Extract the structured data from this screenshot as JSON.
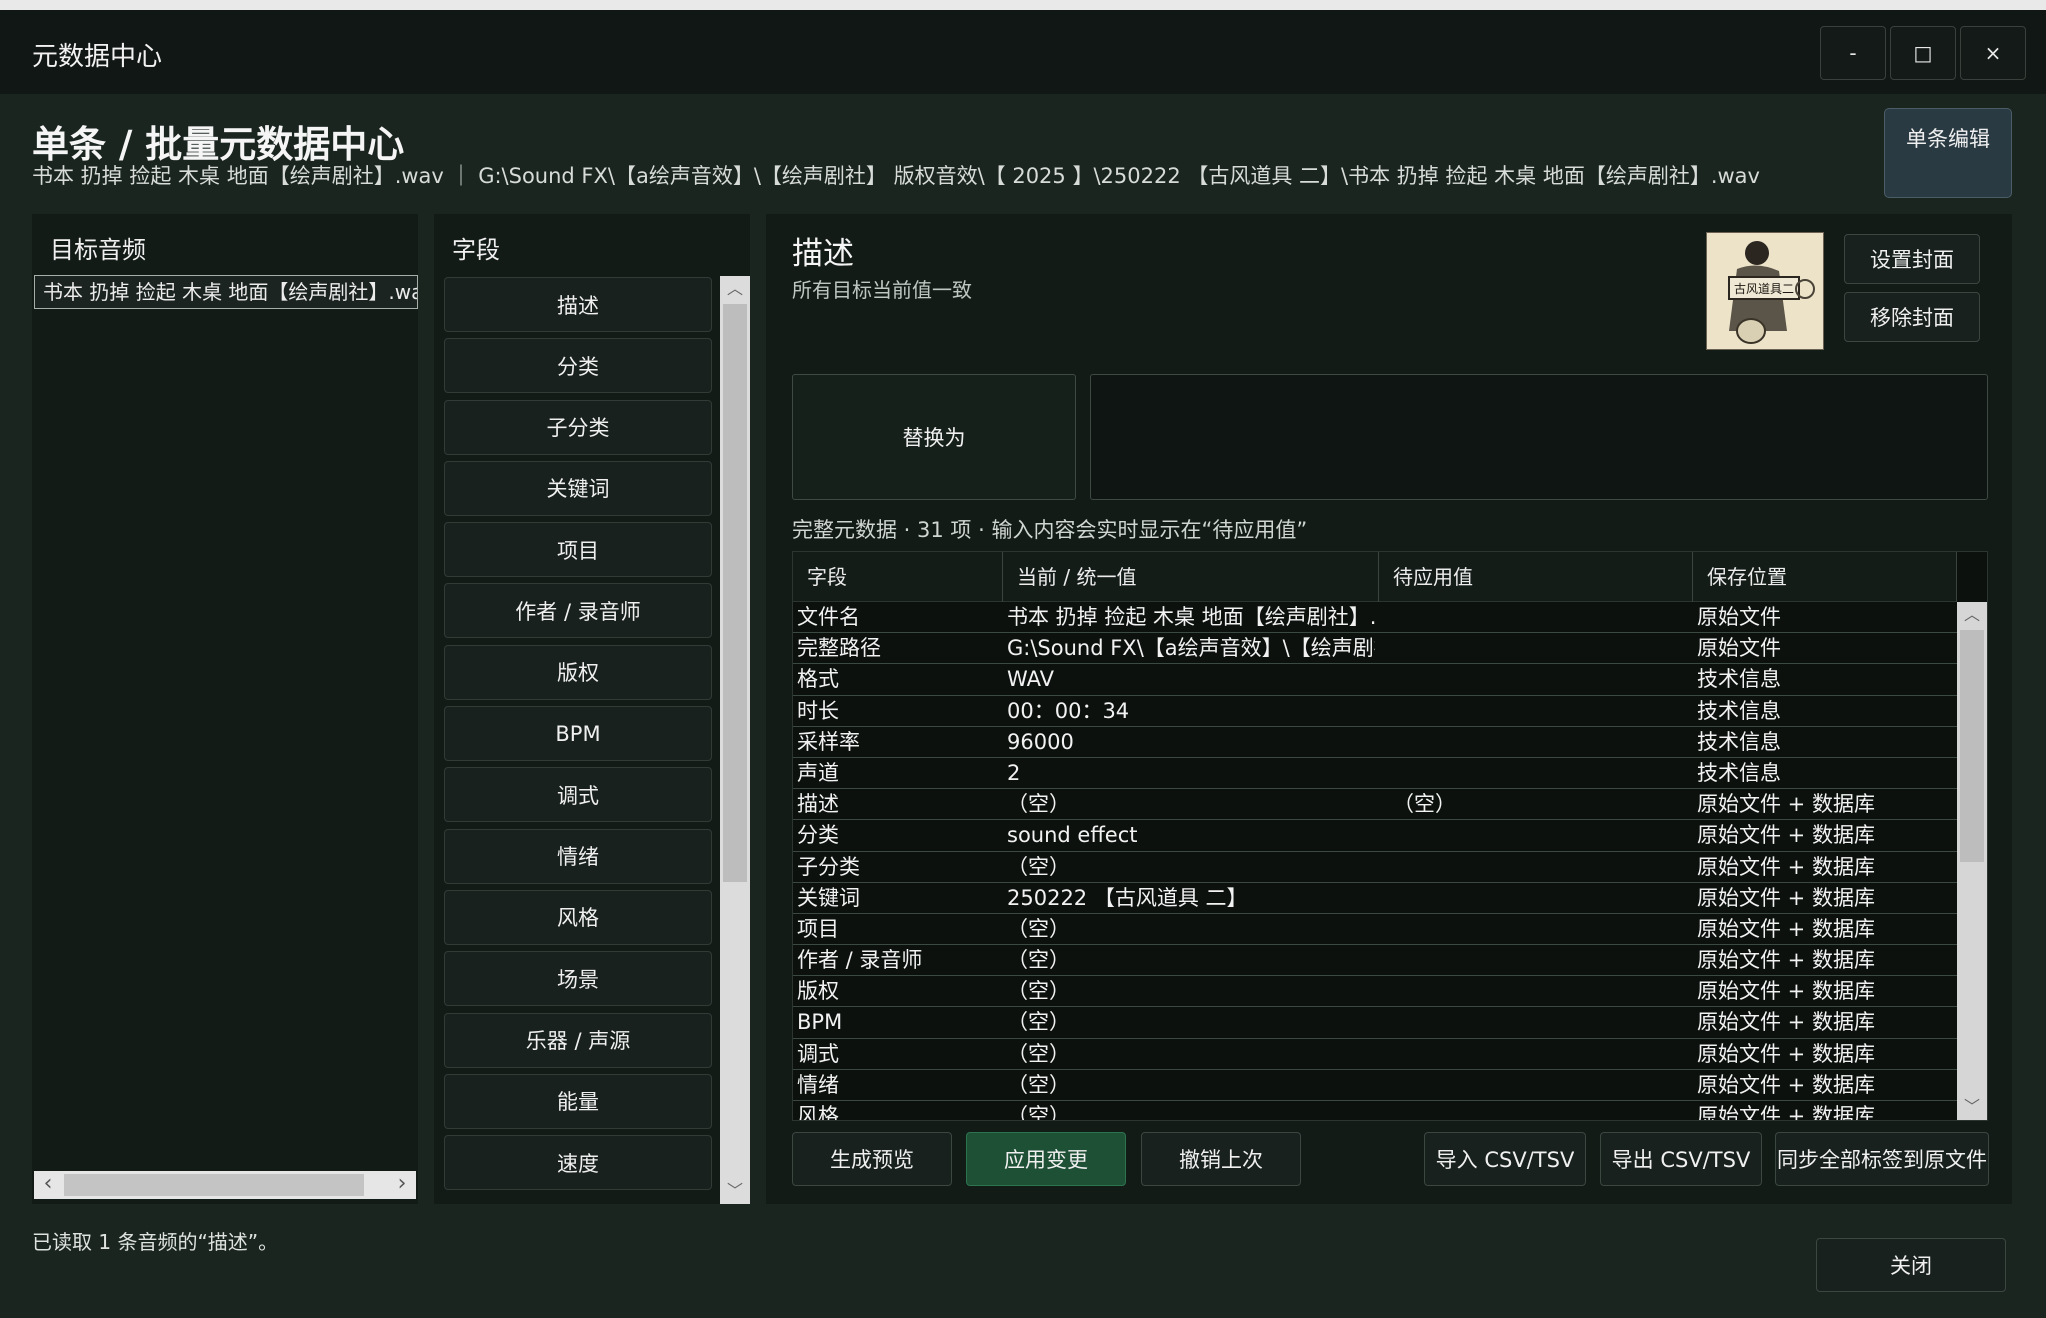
{
  "window": {
    "title": "元数据中心",
    "controls": {
      "minimize": "-",
      "maximize": "□",
      "close": "×"
    }
  },
  "header": {
    "title": "单条 / 批量元数据中心",
    "path": "书本 扔掉 捡起 木桌 地面【绘声剧社】.wav ｜ G:\\Sound FX\\【a绘声音效】\\【绘声剧社】 版权音效\\【 2025 】\\250222 【古风道具 二】\\书本 扔掉 捡起 木桌 地面【绘声剧社】.wav",
    "single_edit_label": "单条编辑"
  },
  "targets": {
    "title": "目标音频",
    "items": [
      "书本 扔掉 捡起 木桌 地面【绘声剧社】.wav"
    ]
  },
  "fields": {
    "title": "字段",
    "items": [
      "描述",
      "分类",
      "子分类",
      "关键词",
      "项目",
      "作者 / 录音师",
      "版权",
      "BPM",
      "调式",
      "情绪",
      "风格",
      "场景",
      "乐器 / 声源",
      "能量",
      "速度"
    ]
  },
  "editor": {
    "field_title": "描述",
    "field_subtitle": "所有目标当前值一致",
    "cover": {
      "text": "古风道具二",
      "set_label": "设置封面",
      "remove_label": "移除封面"
    },
    "replace_label": "替换为",
    "replace_value": "",
    "meta_note": "完整元数据 · 31 项 · 输入内容会实时显示在“待应用值”"
  },
  "table": {
    "columns": [
      "字段",
      "当前 / 统一值",
      "待应用值",
      "保存位置"
    ],
    "rows": [
      [
        "文件名",
        "书本 扔掉 捡起 木桌 地面【绘声剧社】.wav",
        "",
        "原始文件"
      ],
      [
        "完整路径",
        "G:\\Sound FX\\【a绘声音效】\\【绘声剧社】",
        "",
        "原始文件"
      ],
      [
        "格式",
        "WAV",
        "",
        "技术信息"
      ],
      [
        "时长",
        "00：00：34",
        "",
        "技术信息"
      ],
      [
        "采样率",
        "96000",
        "",
        "技术信息"
      ],
      [
        "声道",
        "2",
        "",
        "技术信息"
      ],
      [
        "描述",
        "（空）",
        "（空）",
        "原始文件 + 数据库"
      ],
      [
        "分类",
        "sound effect",
        "",
        "原始文件 + 数据库"
      ],
      [
        "子分类",
        "（空）",
        "",
        "原始文件 + 数据库"
      ],
      [
        "关键词",
        "250222 【古风道具 二】",
        "",
        "原始文件 + 数据库"
      ],
      [
        "项目",
        "（空）",
        "",
        "原始文件 + 数据库"
      ],
      [
        "作者 / 录音师",
        "（空）",
        "",
        "原始文件 + 数据库"
      ],
      [
        "版权",
        "（空）",
        "",
        "原始文件 + 数据库"
      ],
      [
        "BPM",
        "（空）",
        "",
        "原始文件 + 数据库"
      ],
      [
        "调式",
        "（空）",
        "",
        "原始文件 + 数据库"
      ],
      [
        "情绪",
        "（空）",
        "",
        "原始文件 + 数据库"
      ],
      [
        "风格",
        "（空）",
        "",
        "原始文件 + 数据库"
      ]
    ]
  },
  "actions": {
    "preview": "生成预览",
    "apply": "应用变更",
    "undo": "撤销上次",
    "import_csv": "导入 CSV/TSV",
    "export_csv": "导出 CSV/TSV",
    "sync_tags": "同步全部标签到原文件",
    "close": "关闭"
  },
  "status": "已读取 1 条音频的“描述”。"
}
